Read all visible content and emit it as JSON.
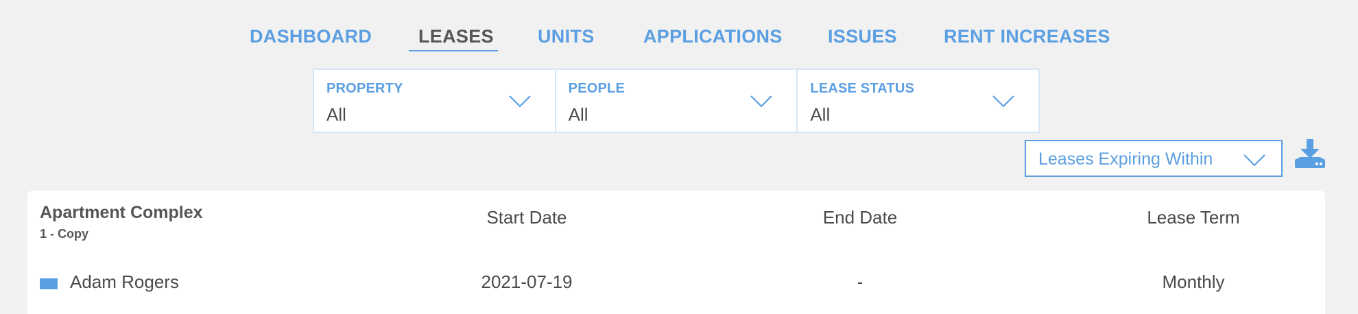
{
  "nav": {
    "tabs": [
      {
        "label": "DASHBOARD"
      },
      {
        "label": "LEASES",
        "active": true
      },
      {
        "label": "UNITS"
      },
      {
        "label": "APPLICATIONS"
      },
      {
        "label": "ISSUES"
      },
      {
        "label": "RENT INCREASES"
      }
    ]
  },
  "filters": [
    {
      "label": "PROPERTY",
      "value": "All"
    },
    {
      "label": "PEOPLE",
      "value": "All"
    },
    {
      "label": "LEASE STATUS",
      "value": "All"
    }
  ],
  "expiring_select": {
    "label": "Leases Expiring Within",
    "icon": "chevron-down-icon"
  },
  "download": {
    "icon": "download-icon"
  },
  "table": {
    "group": {
      "name": "Apartment Complex",
      "sub": "1 - Copy"
    },
    "columns": [
      "Start Date",
      "End Date",
      "Lease Term"
    ],
    "rows": [
      {
        "name": "Adam Rogers",
        "start_date": "2021-07-19",
        "end_date": "-",
        "lease_term": "Monthly"
      }
    ]
  },
  "colors": {
    "accent": "#5b9fe3",
    "text": "#4a4a4a",
    "background": "#f1f1f1",
    "border": "#d6e6f6"
  }
}
